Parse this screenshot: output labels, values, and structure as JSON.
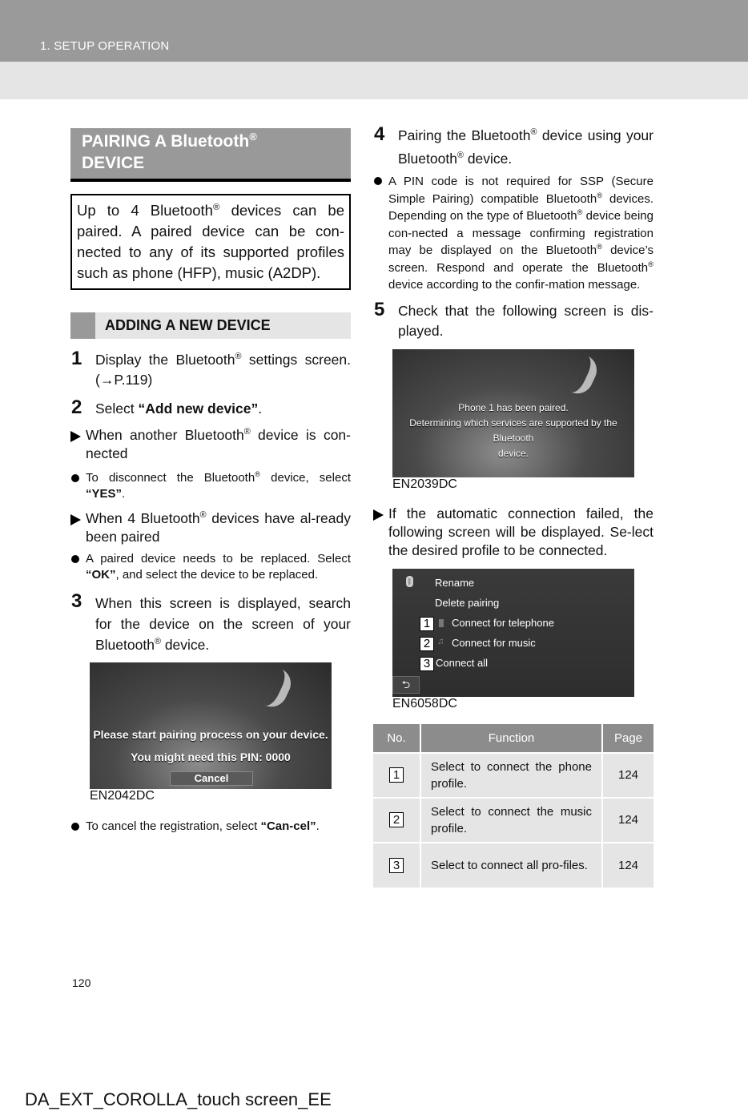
{
  "header": {
    "section": "1. SETUP OPERATION"
  },
  "left": {
    "title_line1": "PAIRING A Bluetooth",
    "title_sup": "®",
    "title_line2": "DEVICE",
    "intro_a": "Up to 4 Bluetooth",
    "intro_sup": "®",
    "intro_b": " devices can be paired. A paired device can be con-nected to any of its supported profiles such as phone (HFP), music (A2DP).",
    "subheading": "ADDING A NEW DEVICE",
    "step1": {
      "num": "1",
      "a": "Display the Bluetooth",
      "sup": "®",
      "b": " settings screen. (→P.119)"
    },
    "step2": {
      "num": "2",
      "a": "Select ",
      "bold": "“Add new device”",
      "b": "."
    },
    "arrow1": {
      "a": "When another Bluetooth",
      "sup": "®",
      "b": " device is con-nected"
    },
    "bullet1": {
      "a": "To disconnect the Bluetooth",
      "sup": "®",
      "b": " device, select ",
      "bold": "“YES”",
      "c": "."
    },
    "arrow2": {
      "a": "When 4 Bluetooth",
      "sup": "®",
      "b": " devices have al-ready been paired"
    },
    "bullet2": {
      "a": "A paired device needs to be replaced. Select ",
      "bold": "“OK”",
      "b": ", and select the device to be replaced."
    },
    "step3": {
      "num": "3",
      "a": "When this screen is displayed, search for the device on the screen of your Bluetooth",
      "sup": "®",
      "b": " device."
    },
    "screen1": {
      "line1": "Please start pairing process on your device.",
      "line2": "You might need this PIN:  0000",
      "cancel": "Cancel",
      "code": "EN2042DC"
    },
    "bullet3": {
      "a": "To cancel the registration, select ",
      "bold": "“Can-cel”",
      "b": "."
    }
  },
  "right": {
    "step4": {
      "num": "4",
      "a": "Pairing the Bluetooth",
      "sup": "®",
      "b": " device using your Bluetooth",
      "sup2": "®",
      "c": " device."
    },
    "bullet4": {
      "a": "A PIN code is not required for SSP (Secure Simple Pairing) compatible Bluetooth",
      "sup": "®",
      "b": " devices. Depending on the type of Bluetooth",
      "sup2": "®",
      "c": " device being con-nected a message confirming registration may be displayed on the Bluetooth",
      "sup3": "®",
      "d": " device’s screen. Respond and operate the Bluetooth",
      "sup4": "®",
      "e": " device according to the confir-mation message."
    },
    "step5": {
      "num": "5",
      "text": "Check that the following screen is dis-played."
    },
    "screen2": {
      "line1": "Phone 1 has been paired.",
      "line2": "Determining which services are supported by the Bluetooth",
      "line3": "device.",
      "code": "EN2039DC"
    },
    "arrow3": {
      "text": "If the automatic connection failed, the following screen will be displayed. Se-lect the desired profile to be connected."
    },
    "screen3": {
      "items": [
        "Rename",
        "Delete pairing",
        "Connect for telephone",
        "Connect for music",
        "Connect all"
      ],
      "callouts": [
        "1",
        "2",
        "3"
      ],
      "back": "⮌",
      "code": "EN6058DC"
    },
    "table": {
      "headers": [
        "No.",
        "Function",
        "Page"
      ],
      "rows": [
        {
          "no": "1",
          "function": "Select to connect the phone profile.",
          "page": "124"
        },
        {
          "no": "2",
          "function": "Select to connect the music profile.",
          "page": "124"
        },
        {
          "no": "3",
          "function": "Select to connect all pro-files.",
          "page": "124"
        }
      ]
    }
  },
  "page_number": "120",
  "footer": "DA_EXT_COROLLA_touch screen_EE"
}
